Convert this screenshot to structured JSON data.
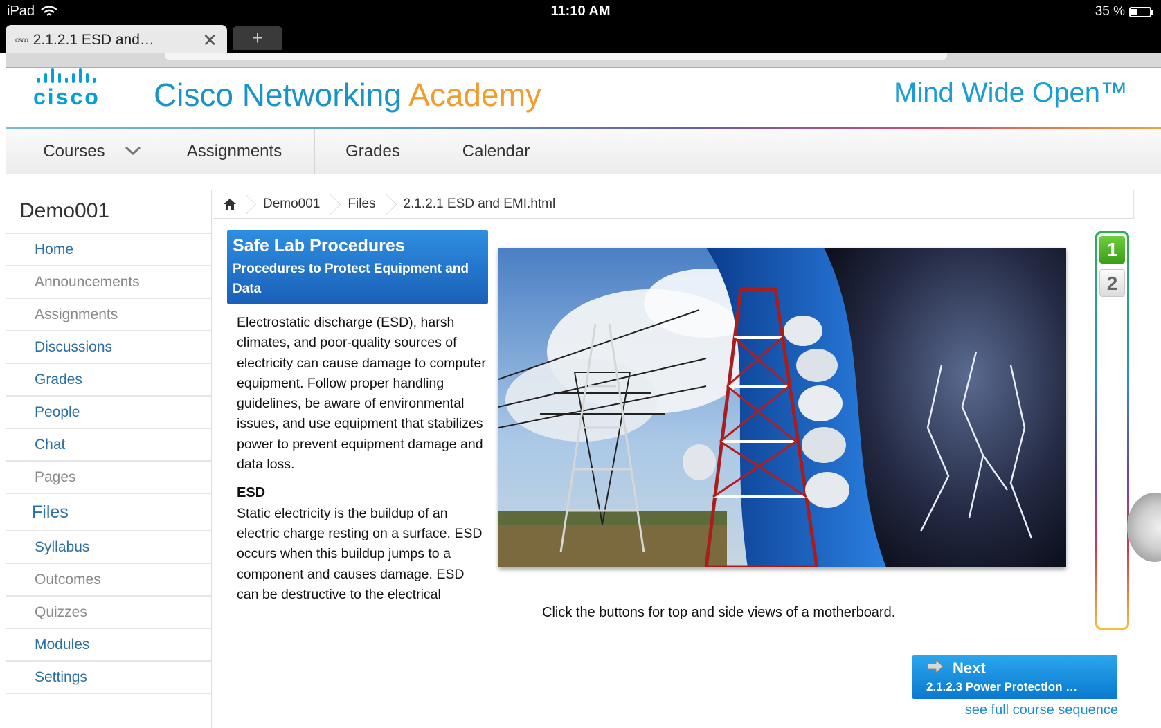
{
  "status_bar": {
    "device": "iPad",
    "time": "11:10 AM",
    "battery": "35 %",
    "battery_level": 0.35
  },
  "browser": {
    "tab_title": "2.1.2.1 ESD and…",
    "tab_favicon_text": "cisco",
    "new_tab_label": "+",
    "close_glyph": "✕"
  },
  "header": {
    "logo_text": "cisco",
    "title_part1": "Cisco Networking",
    "title_part2": "Academy",
    "tagline": "Mind Wide Open™"
  },
  "top_nav": {
    "items": [
      {
        "label": "Courses"
      },
      {
        "label": "Assignments"
      },
      {
        "label": "Grades"
      },
      {
        "label": "Calendar"
      }
    ]
  },
  "sidebar": {
    "course_title": "Demo001",
    "items": [
      {
        "label": "Home",
        "state": "on"
      },
      {
        "label": "Announcements",
        "state": "off"
      },
      {
        "label": "Assignments",
        "state": "off"
      },
      {
        "label": "Discussions",
        "state": "on"
      },
      {
        "label": "Grades",
        "state": "on"
      },
      {
        "label": "People",
        "state": "on"
      },
      {
        "label": "Chat",
        "state": "on"
      },
      {
        "label": "Pages",
        "state": "off"
      },
      {
        "label": "Files",
        "state": "current"
      },
      {
        "label": "Syllabus",
        "state": "on"
      },
      {
        "label": "Outcomes",
        "state": "off"
      },
      {
        "label": "Quizzes",
        "state": "off"
      },
      {
        "label": "Modules",
        "state": "on"
      },
      {
        "label": "Settings",
        "state": "on"
      }
    ]
  },
  "breadcrumb": {
    "items": [
      "Demo001",
      "Files",
      "2.1.2.1 ESD and EMI.html"
    ]
  },
  "lesson": {
    "title": "Safe Lab Procedures",
    "subtitle": "Procedures to Protect Equipment and Data",
    "paragraph1": "Electrostatic discharge (ESD), harsh climates, and poor-quality sources of electricity can cause damage to computer equipment. Follow proper handling guidelines, be aware of environmental issues, and use equipment that stabilizes power to prevent equipment damage and data loss.",
    "section_heading": "ESD",
    "paragraph2": "Static electricity is the buildup of an electric charge resting on a surface. ESD occurs when this buildup jumps to a component and causes damage. ESD can be destructive to the electrical"
  },
  "media": {
    "instruction": "Click the buttons for top and side views of a motherboard."
  },
  "pager": {
    "pages": [
      "1",
      "2"
    ],
    "active": "1"
  },
  "next": {
    "label": "Next",
    "target": "2.1.2.3 Power Protection …",
    "sequence_link": "see full course sequence"
  },
  "colors": {
    "brand_blue": "#049fd9",
    "link_blue": "#2a6fa8",
    "academy_orange": "#f29c2b",
    "header_blue": "#1a60b8",
    "active_green": "#3a9e1a"
  }
}
